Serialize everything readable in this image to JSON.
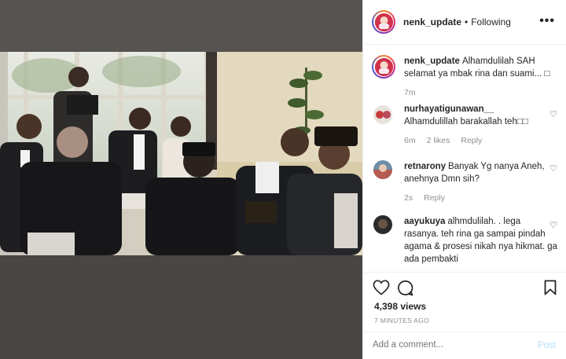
{
  "post": {
    "username": "nenk_update",
    "separator": "•",
    "follow_status": "Following",
    "more_label": "•••"
  },
  "caption": {
    "username": "nenk_update",
    "text": "Alhamdulilah SAH selamat ya mbak rina dan suami... □",
    "time": "7m"
  },
  "comments": [
    {
      "username": "nurhayatigunawan__",
      "text": "Alhamdulillah barakallah teh□□",
      "time": "6m",
      "likes": "2 likes",
      "reply": "Reply"
    },
    {
      "username": "retnarony",
      "text": "Banyak Yg nanya Aneh, anehnya Dmn sih?",
      "time": "2s",
      "reply": "Reply"
    },
    {
      "username": "aayukuya",
      "text": "alhmdulilah. . lega rasanya. teh rina ga sampai pindah agama & prosesi nikah nya hikmat. ga ada pembakti"
    }
  ],
  "stats": {
    "views": "4,398 views",
    "posted_ago": "7 MINUTES AGO"
  },
  "add_comment": {
    "placeholder": "Add a comment...",
    "post_label": "Post"
  },
  "avatar_label": "nenk_upd",
  "icons": [
    "heart-icon",
    "comment-icon",
    "bookmark-icon",
    "more-icon"
  ],
  "colors": {
    "link_disabled": "#b2dffc",
    "muted": "#8e8e8e",
    "text": "#262626",
    "avatar_ring_start": "#f58529",
    "avatar_ring_end": "#515bd4"
  }
}
